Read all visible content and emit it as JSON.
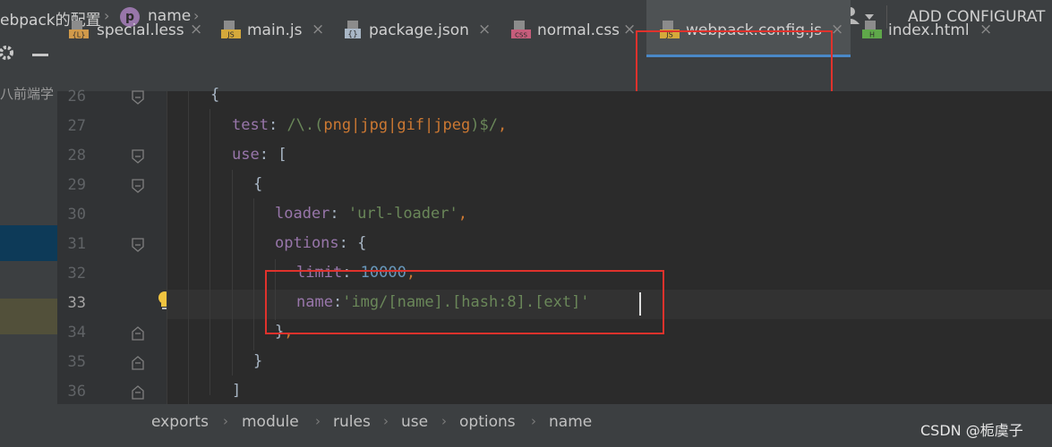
{
  "nav": {
    "project_crumb": "ebpack的配置",
    "chevron": "›",
    "item_badge": "p",
    "item_crumb": "name",
    "run_config": "ADD CONFIGURAT"
  },
  "sidebar": {
    "text": "八前端学"
  },
  "tabs": [
    {
      "label": "special.less",
      "icon_type": "less",
      "icon_text": "{L}",
      "close": "×"
    },
    {
      "label": "main.js",
      "icon_type": "js",
      "icon_text": "JS",
      "close": "×"
    },
    {
      "label": "package.json",
      "icon_type": "json",
      "icon_text": "{}",
      "close": "×"
    },
    {
      "label": "normal.css",
      "icon_type": "css",
      "icon_text": "CSS",
      "close": "×"
    },
    {
      "label": "webpack.config.js",
      "icon_type": "js",
      "icon_text": "JS",
      "close": "×",
      "active": true
    },
    {
      "label": "index.html",
      "icon_type": "html",
      "icon_text": "H",
      "close": "×"
    }
  ],
  "editor": {
    "line_numbers": [
      "26",
      "27",
      "28",
      "29",
      "30",
      "31",
      "32",
      "33",
      "34",
      "35",
      "36"
    ],
    "current_line": "33",
    "code": {
      "l26": {
        "brace": "{"
      },
      "l27": {
        "key": "test",
        "colon": ": ",
        "re_open": "/\\.(",
        "a": "png",
        "bar": "|",
        "b": "jpg",
        "c": "gif",
        "d": "jpeg",
        "re_close": ")$/",
        "comma": ","
      },
      "l28": {
        "key": "use",
        "colon": ": ",
        "open": "["
      },
      "l29": {
        "brace": "{"
      },
      "l30": {
        "key": "loader",
        "colon": ": ",
        "value": "'url-loader'",
        "comma": ","
      },
      "l31": {
        "key": "options",
        "colon": ": ",
        "open": "{"
      },
      "l32": {
        "key": "limit",
        "colon": ": ",
        "value": "10000",
        "comma": ","
      },
      "l33": {
        "key": "name",
        "colon": ":",
        "value": "'img/[name].[hash:8].[ext]'"
      },
      "l34": {
        "close": "}",
        "comma": ","
      },
      "l35": {
        "close": "}"
      },
      "l36": {
        "close": "]"
      }
    }
  },
  "breadcrumb": {
    "items": [
      "exports",
      "module",
      "rules",
      "use",
      "options",
      "name"
    ],
    "separator": "›"
  },
  "watermark": "CSDN @栀虞子",
  "colors": {
    "keyword": "#9876aa",
    "string": "#6a8759",
    "number": "#6897bb",
    "operator": "#cc7832",
    "highlight_box": "#e0322c",
    "active_tab_underline": "#4a88c7"
  }
}
